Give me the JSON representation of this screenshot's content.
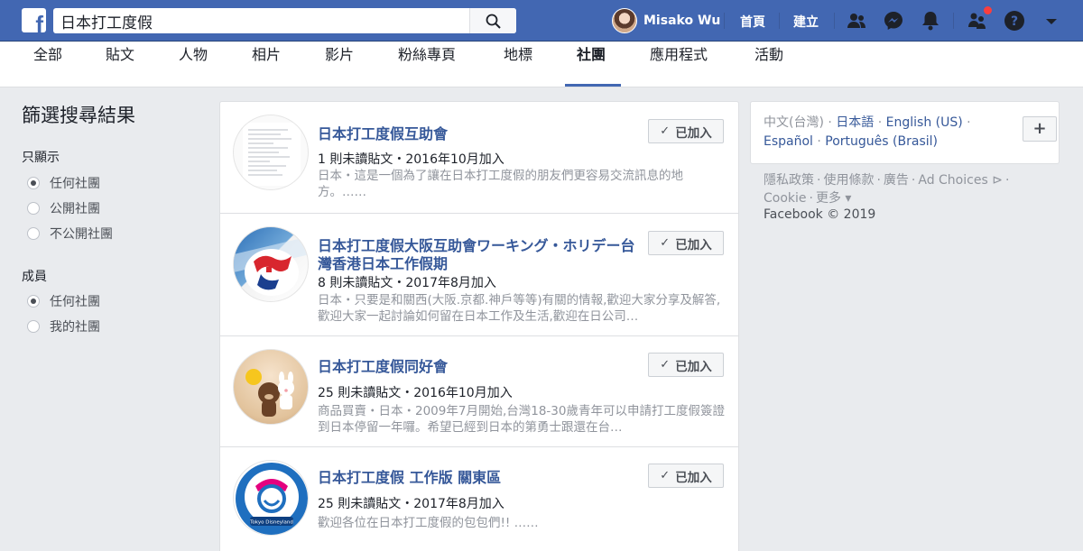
{
  "search": {
    "query": "日本打工度假"
  },
  "topnav": {
    "user_name": "Misako Wu",
    "home_label": "首頁",
    "create_label": "建立"
  },
  "tabs": [
    "全部",
    "貼文",
    "人物",
    "相片",
    "影片",
    "粉絲專頁",
    "地標",
    "社團",
    "應用程式",
    "活動"
  ],
  "active_tab": "社團",
  "filters": {
    "title": "篩選搜尋結果",
    "show_only": {
      "heading": "只顯示",
      "options": [
        "任何社團",
        "公開社團",
        "不公開社團"
      ],
      "selected": "任何社團"
    },
    "members": {
      "heading": "成員",
      "options": [
        "任何社團",
        "我的社團"
      ],
      "selected": "任何社團"
    }
  },
  "results": [
    {
      "title": "日本打工度假互助會",
      "meta": "1 則未讀貼文・2016年10月加入",
      "desc": "日本・這是一個為了讓在日本打工度假的朋友們更容易交流訊息的地方。……",
      "button": "已加入"
    },
    {
      "title": "日本打工度假大阪互助會ワーキング・ホリデー台灣香港日本工作假期",
      "meta": "8 則未讀貼文・2017年8月加入",
      "desc": "日本・只要是和關西(大阪.京都.神戶等等)有關的情報,歡迎大家分享及解答,歡迎大家一起討論如何留在日本工作及生活,歡迎在日公司…",
      "button": "已加入"
    },
    {
      "title": "日本打工度假同好會",
      "meta": "25 則未讀貼文・2016年10月加入",
      "desc": "商品買賣・日本・2009年7月開始,台灣18-30歲青年可以申請打工度假簽證到日本停留一年囉。希望已經到日本的第勇士跟還在台…",
      "button": "已加入"
    },
    {
      "title": "日本打工度假 工作版 關東區",
      "meta": "25 則未讀貼文・2017年8月加入",
      "desc": "歡迎各位在日本打工度假的包包們!! ……",
      "button": "已加入",
      "thumb_text": "Tokyo Disneyland"
    }
  ],
  "languages": {
    "current": "中文(台灣)",
    "links": [
      "日本語",
      "English (US)",
      "Español",
      "Português (Brasil)"
    ],
    "add_label": "+"
  },
  "footer": {
    "links": [
      "隱私政策",
      "使用條款",
      "廣告",
      "Ad Choices",
      "Cookie",
      "更多"
    ],
    "copyright": "Facebook © 2019"
  },
  "colors": {
    "brand": "#4267b2",
    "link": "#365899",
    "notification": "#fa3e3e"
  }
}
